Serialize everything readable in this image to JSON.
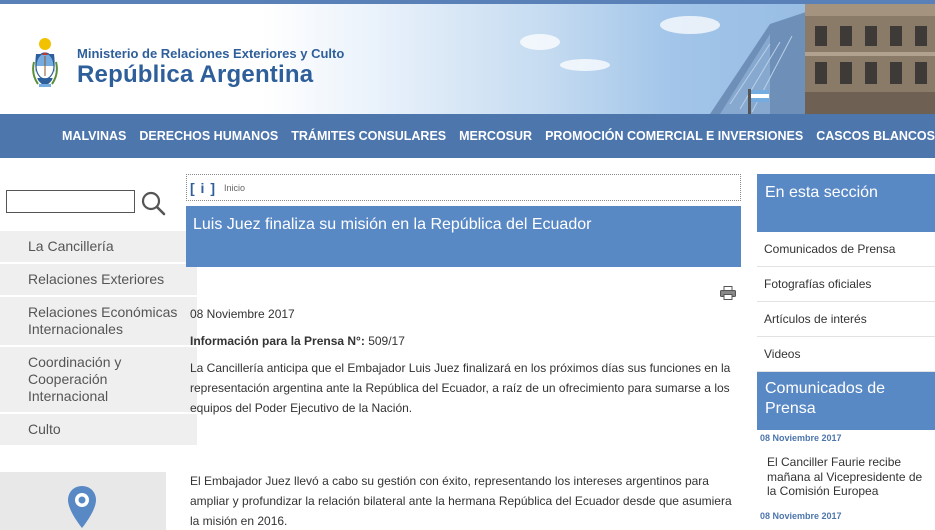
{
  "header": {
    "ministry": "Ministerio de Relaciones Exteriores y Culto",
    "country": "República Argentina"
  },
  "nav": {
    "items": [
      "MALVINAS",
      "DERECHOS HUMANOS",
      "TRÁMITES CONSULARES",
      "MERCOSUR",
      "PROMOCIÓN COMERCIAL E INVERSIONES",
      "CASCOS BLANCOS"
    ]
  },
  "search": {
    "value": "",
    "icon": "search-icon"
  },
  "sidebar": {
    "items": [
      {
        "label": "La Cancillería"
      },
      {
        "label": "Relaciones Exteriores"
      },
      {
        "label": "Relaciones Económicas Internacionales"
      },
      {
        "label": "Coordinación y Cooperación Internacional"
      },
      {
        "label": "Culto"
      }
    ],
    "map_icon": "location-pin-icon"
  },
  "breadcrumb": {
    "icon": "[ i ]",
    "text": "Inicio"
  },
  "article": {
    "title": "Luis Juez finaliza su misión en la República del Ecuador",
    "date": "08 Noviembre 2017",
    "press_label": "Información para la Prensa N°:",
    "press_number": " 509/17",
    "p1": "La Cancillería anticipa que el Embajador Luis Juez finalizará en los próximos días sus funciones en la representación argentina ante la República del Ecuador, a raíz de un ofrecimiento para sumarse a los equipos del Poder Ejecutivo de la Nación.",
    "p2": "El Embajador Juez llevó a cabo su gestión con éxito, representando los intereses argentinos para ampliar y profundizar la relación bilateral ante la hermana República del Ecuador desde que asumiera la misión en 2016.",
    "print_icon": "printer-icon"
  },
  "right": {
    "section_title": "En esta sección",
    "items": [
      "Comunicados de Prensa",
      "Fotografías oficiales",
      "Artículos de interés",
      "Videos"
    ],
    "press_title": "Comunicados de Prensa",
    "news": [
      {
        "date": "08 Noviembre 2017",
        "title": "El Canciller Faurie recibe mañana al Vicepresidente de la Comisión Europea"
      },
      {
        "date": "08 Noviembre 2017"
      }
    ]
  },
  "colors": {
    "nav": "#4d76ad",
    "accent": "#5989c5",
    "brand_text": "#2e5f9a"
  }
}
